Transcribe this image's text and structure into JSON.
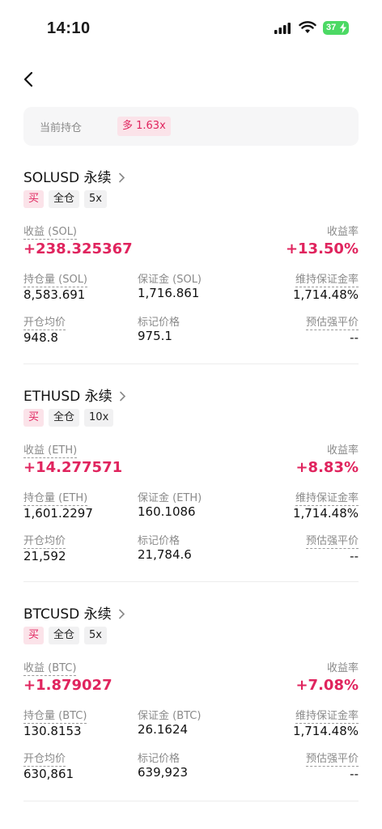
{
  "status_bar": {
    "time": "14:10",
    "battery": "37"
  },
  "summary": {
    "label": "当前持仓",
    "badge": "多 1.63x"
  },
  "positions": [
    {
      "title": "SOLUSD 永续",
      "tags": [
        "买",
        "全仓",
        "5x"
      ],
      "pnl_label": "收益 (SOL)",
      "pnl_value": "+238.325367",
      "roi_label": "收益率",
      "roi_value": "+13.50%",
      "size_label": "持仓量 (SOL)",
      "size_value": "8,583.691",
      "margin_label": "保证金 (SOL)",
      "margin_value": "1,716.861",
      "mmr_label": "维持保证金率",
      "mmr_value": "1,714.48%",
      "entry_label": "开仓均价",
      "entry_value": "948.8",
      "mark_label": "标记价格",
      "mark_value": "975.1",
      "liq_label": "预估强平价",
      "liq_value": "--"
    },
    {
      "title": "ETHUSD 永续",
      "tags": [
        "买",
        "全仓",
        "10x"
      ],
      "pnl_label": "收益 (ETH)",
      "pnl_value": "+14.277571",
      "roi_label": "收益率",
      "roi_value": "+8.83%",
      "size_label": "持仓量 (ETH)",
      "size_value": "1,601.2297",
      "margin_label": "保证金 (ETH)",
      "margin_value": "160.1086",
      "mmr_label": "维持保证金率",
      "mmr_value": "1,714.48%",
      "entry_label": "开仓均价",
      "entry_value": "21,592",
      "mark_label": "标记价格",
      "mark_value": "21,784.6",
      "liq_label": "预估强平价",
      "liq_value": "--"
    },
    {
      "title": "BTCUSD 永续",
      "tags": [
        "买",
        "全仓",
        "5x"
      ],
      "pnl_label": "收益 (BTC)",
      "pnl_value": "+1.879027",
      "roi_label": "收益率",
      "roi_value": "+7.08%",
      "size_label": "持仓量 (BTC)",
      "size_value": "130.8153",
      "margin_label": "保证金 (BTC)",
      "margin_value": "26.1624",
      "mmr_label": "维持保证金率",
      "mmr_value": "1,714.48%",
      "entry_label": "开仓均价",
      "entry_value": "630,861",
      "mark_label": "标记价格",
      "mark_value": "639,923",
      "liq_label": "预估强平价",
      "liq_value": "--"
    }
  ],
  "colors": {
    "accent": "#e0245e",
    "badge_bg": "#fbe3e9",
    "label": "#8a8a8a"
  },
  "icons": [
    "signal-icon",
    "wifi-icon",
    "battery-icon",
    "back-icon",
    "chevron-right-icon"
  ]
}
